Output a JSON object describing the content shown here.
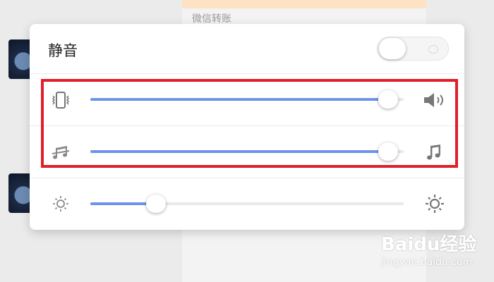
{
  "background": {
    "text": "微信转账"
  },
  "volume_panel": {
    "mute": {
      "label": "静音",
      "enabled": false
    },
    "sliders": [
      {
        "name": "ringer-volume",
        "left_icon": "vibrate-icon",
        "right_icon": "speaker-volume-icon",
        "value": 0.95
      },
      {
        "name": "media-volume",
        "left_icon": "music-muted-icon",
        "right_icon": "music-note-icon",
        "value": 0.95
      },
      {
        "name": "brightness",
        "left_icon": "brightness-low-icon",
        "right_icon": "brightness-high-icon",
        "value": 0.21
      }
    ]
  },
  "colors": {
    "accent": "#6f93e8",
    "highlight": "#e01f2a"
  },
  "watermark": {
    "title": "Baidu经验",
    "subtitle": "jingyan.baidu.com"
  }
}
